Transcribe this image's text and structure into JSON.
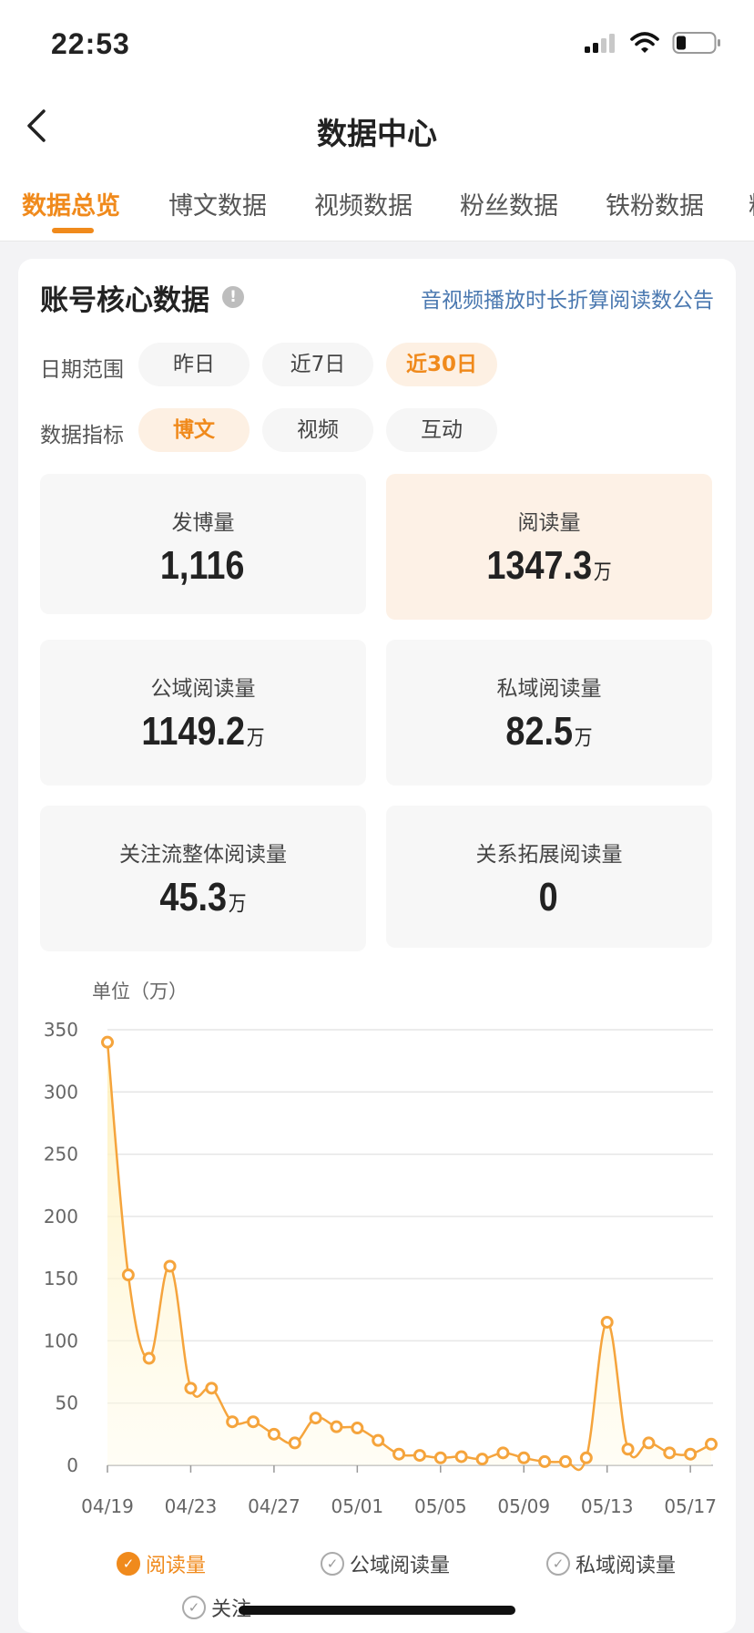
{
  "status_bar": {
    "time": "22:53"
  },
  "header": {
    "title": "数据中心",
    "back_icon": "chevron-left-icon"
  },
  "tabs": [
    {
      "label": "数据总览",
      "active": true
    },
    {
      "label": "博文数据",
      "active": false
    },
    {
      "label": "视频数据",
      "active": false
    },
    {
      "label": "粉丝数据",
      "active": false
    },
    {
      "label": "铁粉数据",
      "active": false
    },
    {
      "label": "粉",
      "active": false
    }
  ],
  "core": {
    "title": "账号核心数据",
    "info_icon": "info-icon",
    "notice_link": "音视频播放时长折算阅读数公告",
    "date_range": {
      "label": "日期范围",
      "options": [
        "昨日",
        "近7日",
        "近30日"
      ],
      "selected": "近30日"
    },
    "metric": {
      "label": "数据指标",
      "options": [
        "博文",
        "视频",
        "互动"
      ],
      "selected": "博文"
    },
    "stats": [
      {
        "label": "发博量",
        "value": "1,116",
        "unit": ""
      },
      {
        "label": "阅读量",
        "value": "1347.3",
        "unit": "万"
      },
      {
        "label": "公域阅读量",
        "value": "1149.2",
        "unit": "万"
      },
      {
        "label": "私域阅读量",
        "value": "82.5",
        "unit": "万"
      },
      {
        "label": "关注流整体阅读量",
        "value": "45.3",
        "unit": "万"
      },
      {
        "label": "关系拓展阅读量",
        "value": "0",
        "unit": ""
      }
    ]
  },
  "chart_data": {
    "type": "area",
    "unit_label": "单位（万）",
    "x": [
      "04/19",
      "04/20",
      "04/21",
      "04/22",
      "04/23",
      "04/24",
      "04/25",
      "04/26",
      "04/27",
      "04/28",
      "04/29",
      "04/30",
      "05/01",
      "05/02",
      "05/03",
      "05/04",
      "05/05",
      "05/06",
      "05/07",
      "05/08",
      "05/09",
      "05/10",
      "05/11",
      "05/12",
      "05/13",
      "05/14",
      "05/15",
      "05/16",
      "05/17",
      "05/18"
    ],
    "x_tick_labels": [
      "04/19",
      "04/23",
      "04/27",
      "05/01",
      "05/05",
      "05/09",
      "05/13",
      "05/17"
    ],
    "y_ticks": [
      0,
      50,
      100,
      150,
      200,
      250,
      300,
      350
    ],
    "ylim": [
      0,
      350
    ],
    "series": [
      {
        "name": "阅读量",
        "color": "#f5a43c",
        "values": [
          340,
          153,
          86,
          160,
          62,
          62,
          35,
          35,
          25,
          18,
          38,
          31,
          30,
          20,
          9,
          8,
          6,
          7,
          5,
          10,
          6,
          3,
          3,
          6,
          115,
          13,
          18,
          10,
          9,
          17
        ]
      }
    ],
    "legend": [
      {
        "label": "阅读量",
        "checked": true
      },
      {
        "label": "公域阅读量",
        "checked": false
      },
      {
        "label": "私域阅读量",
        "checked": false
      },
      {
        "label": "关注",
        "checked": false
      }
    ],
    "grid": true
  }
}
